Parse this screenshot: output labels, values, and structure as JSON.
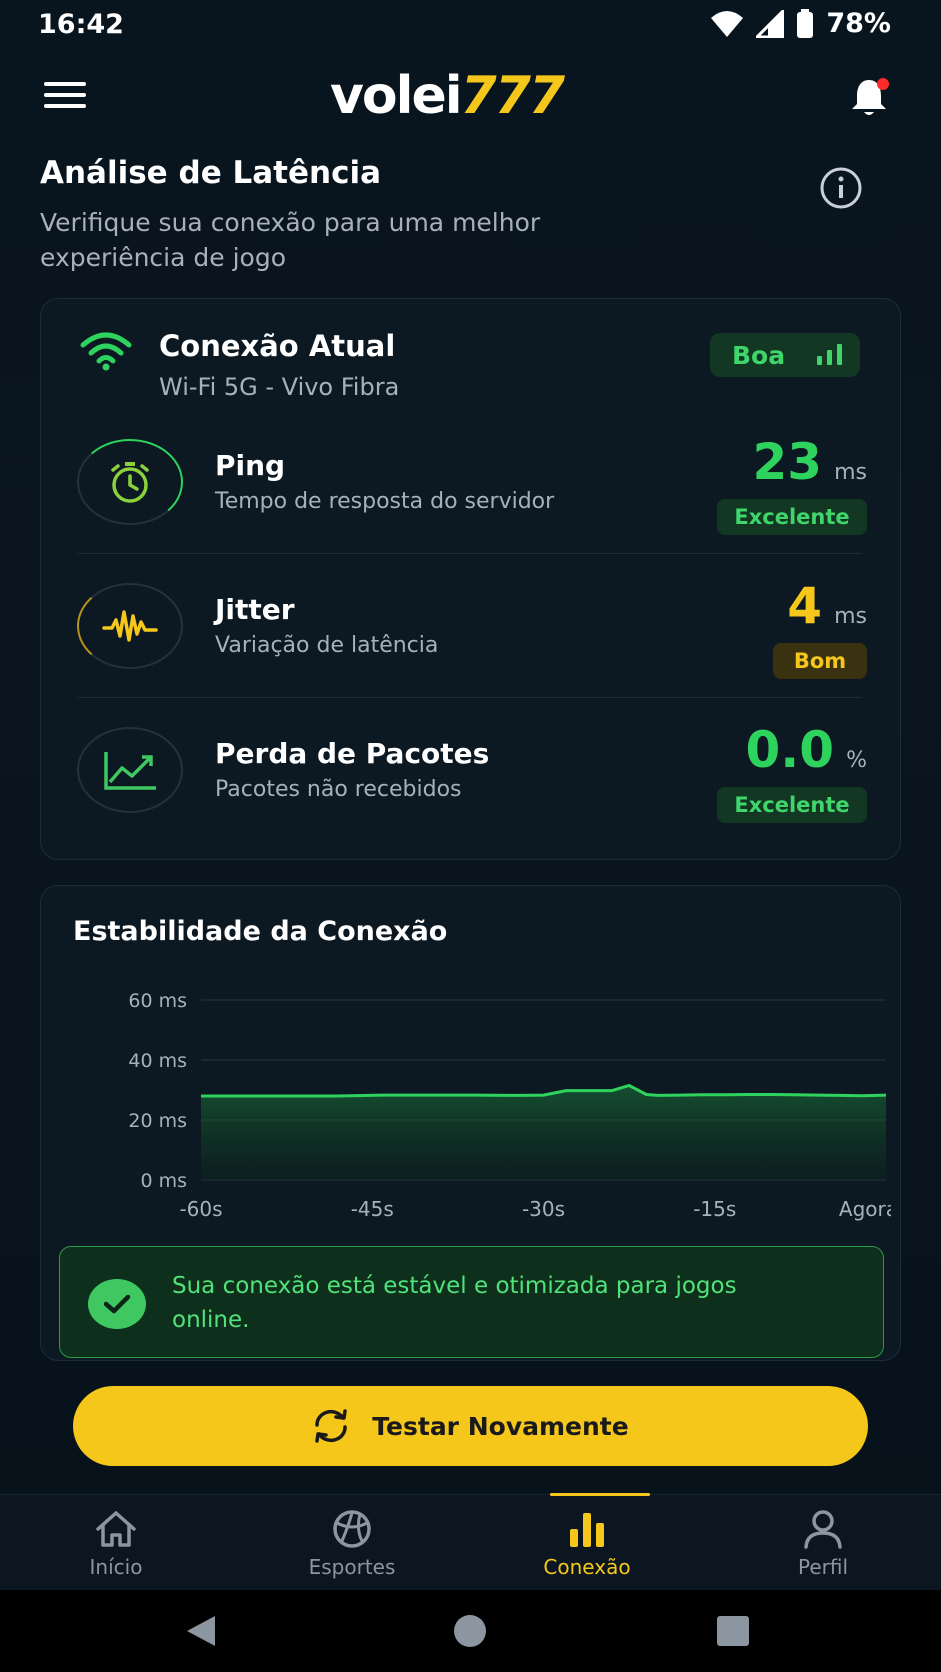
{
  "status_bar": {
    "time": "16:42",
    "battery": "78%"
  },
  "header": {
    "logo_white": "volei",
    "logo_yellow": "777"
  },
  "page": {
    "title": "Análise de Latência",
    "subtitle": "Verifique sua conexão para uma melhor experiência de jogo"
  },
  "connection": {
    "title": "Conexão Atual",
    "network": "Wi-Fi 5G - Vivo Fibra",
    "quality": "Boa"
  },
  "metrics": [
    {
      "name": "Ping",
      "desc": "Tempo de resposta do servidor",
      "value": "23",
      "unit": "ms",
      "rating": "Excelente"
    },
    {
      "name": "Jitter",
      "desc": "Variação de latência",
      "value": "4",
      "unit": "ms",
      "rating": "Bom"
    },
    {
      "name": "Perda de Pacotes",
      "desc": "Pacotes não recebidos",
      "value": "0.0",
      "unit": "%",
      "rating": "Excelente"
    }
  ],
  "stability": {
    "title": "Estabilidade da Conexão",
    "message": "Sua conexão está estável e otimizada para jogos online."
  },
  "chart_data": {
    "type": "area",
    "title": "Estabilidade da Conexão",
    "xlabel": "",
    "ylabel": "",
    "x_ticks": [
      "-60s",
      "-45s",
      "-30s",
      "-15s",
      "Agora"
    ],
    "y_ticks": [
      "60 ms",
      "40 ms",
      "20 ms",
      "0 ms"
    ],
    "ylim": [
      0,
      60
    ],
    "xlim": [
      -60,
      0
    ],
    "grid": true,
    "x": [
      -60,
      -56,
      -52,
      -48,
      -44,
      -40,
      -36,
      -32,
      -30,
      -28,
      -26,
      -24,
      -22.5,
      -21,
      -20,
      -18,
      -16,
      -14,
      -12,
      -10,
      -8,
      -6,
      -4,
      -2,
      0
    ],
    "y": [
      28,
      28,
      28,
      28,
      28.3,
      28.3,
      28.3,
      28.2,
      28.3,
      29.8,
      29.8,
      29.8,
      31.5,
      28.5,
      28.2,
      28.3,
      28.4,
      28.4,
      28.5,
      28.5,
      28.4,
      28.3,
      28.2,
      28.1,
      28.3
    ],
    "color": "#2ed35e"
  },
  "actions": {
    "retest": "Testar Novamente"
  },
  "bottom_nav": [
    {
      "label": "Início",
      "icon": "home-icon"
    },
    {
      "label": "Esportes",
      "icon": "ball-icon"
    },
    {
      "label": "Conexão",
      "icon": "bar-chart-icon",
      "active": true
    },
    {
      "label": "Perfil",
      "icon": "user-icon"
    }
  ],
  "colors": {
    "accent": "#f6c71b",
    "good": "#2ed35e",
    "background": "#08141e"
  }
}
